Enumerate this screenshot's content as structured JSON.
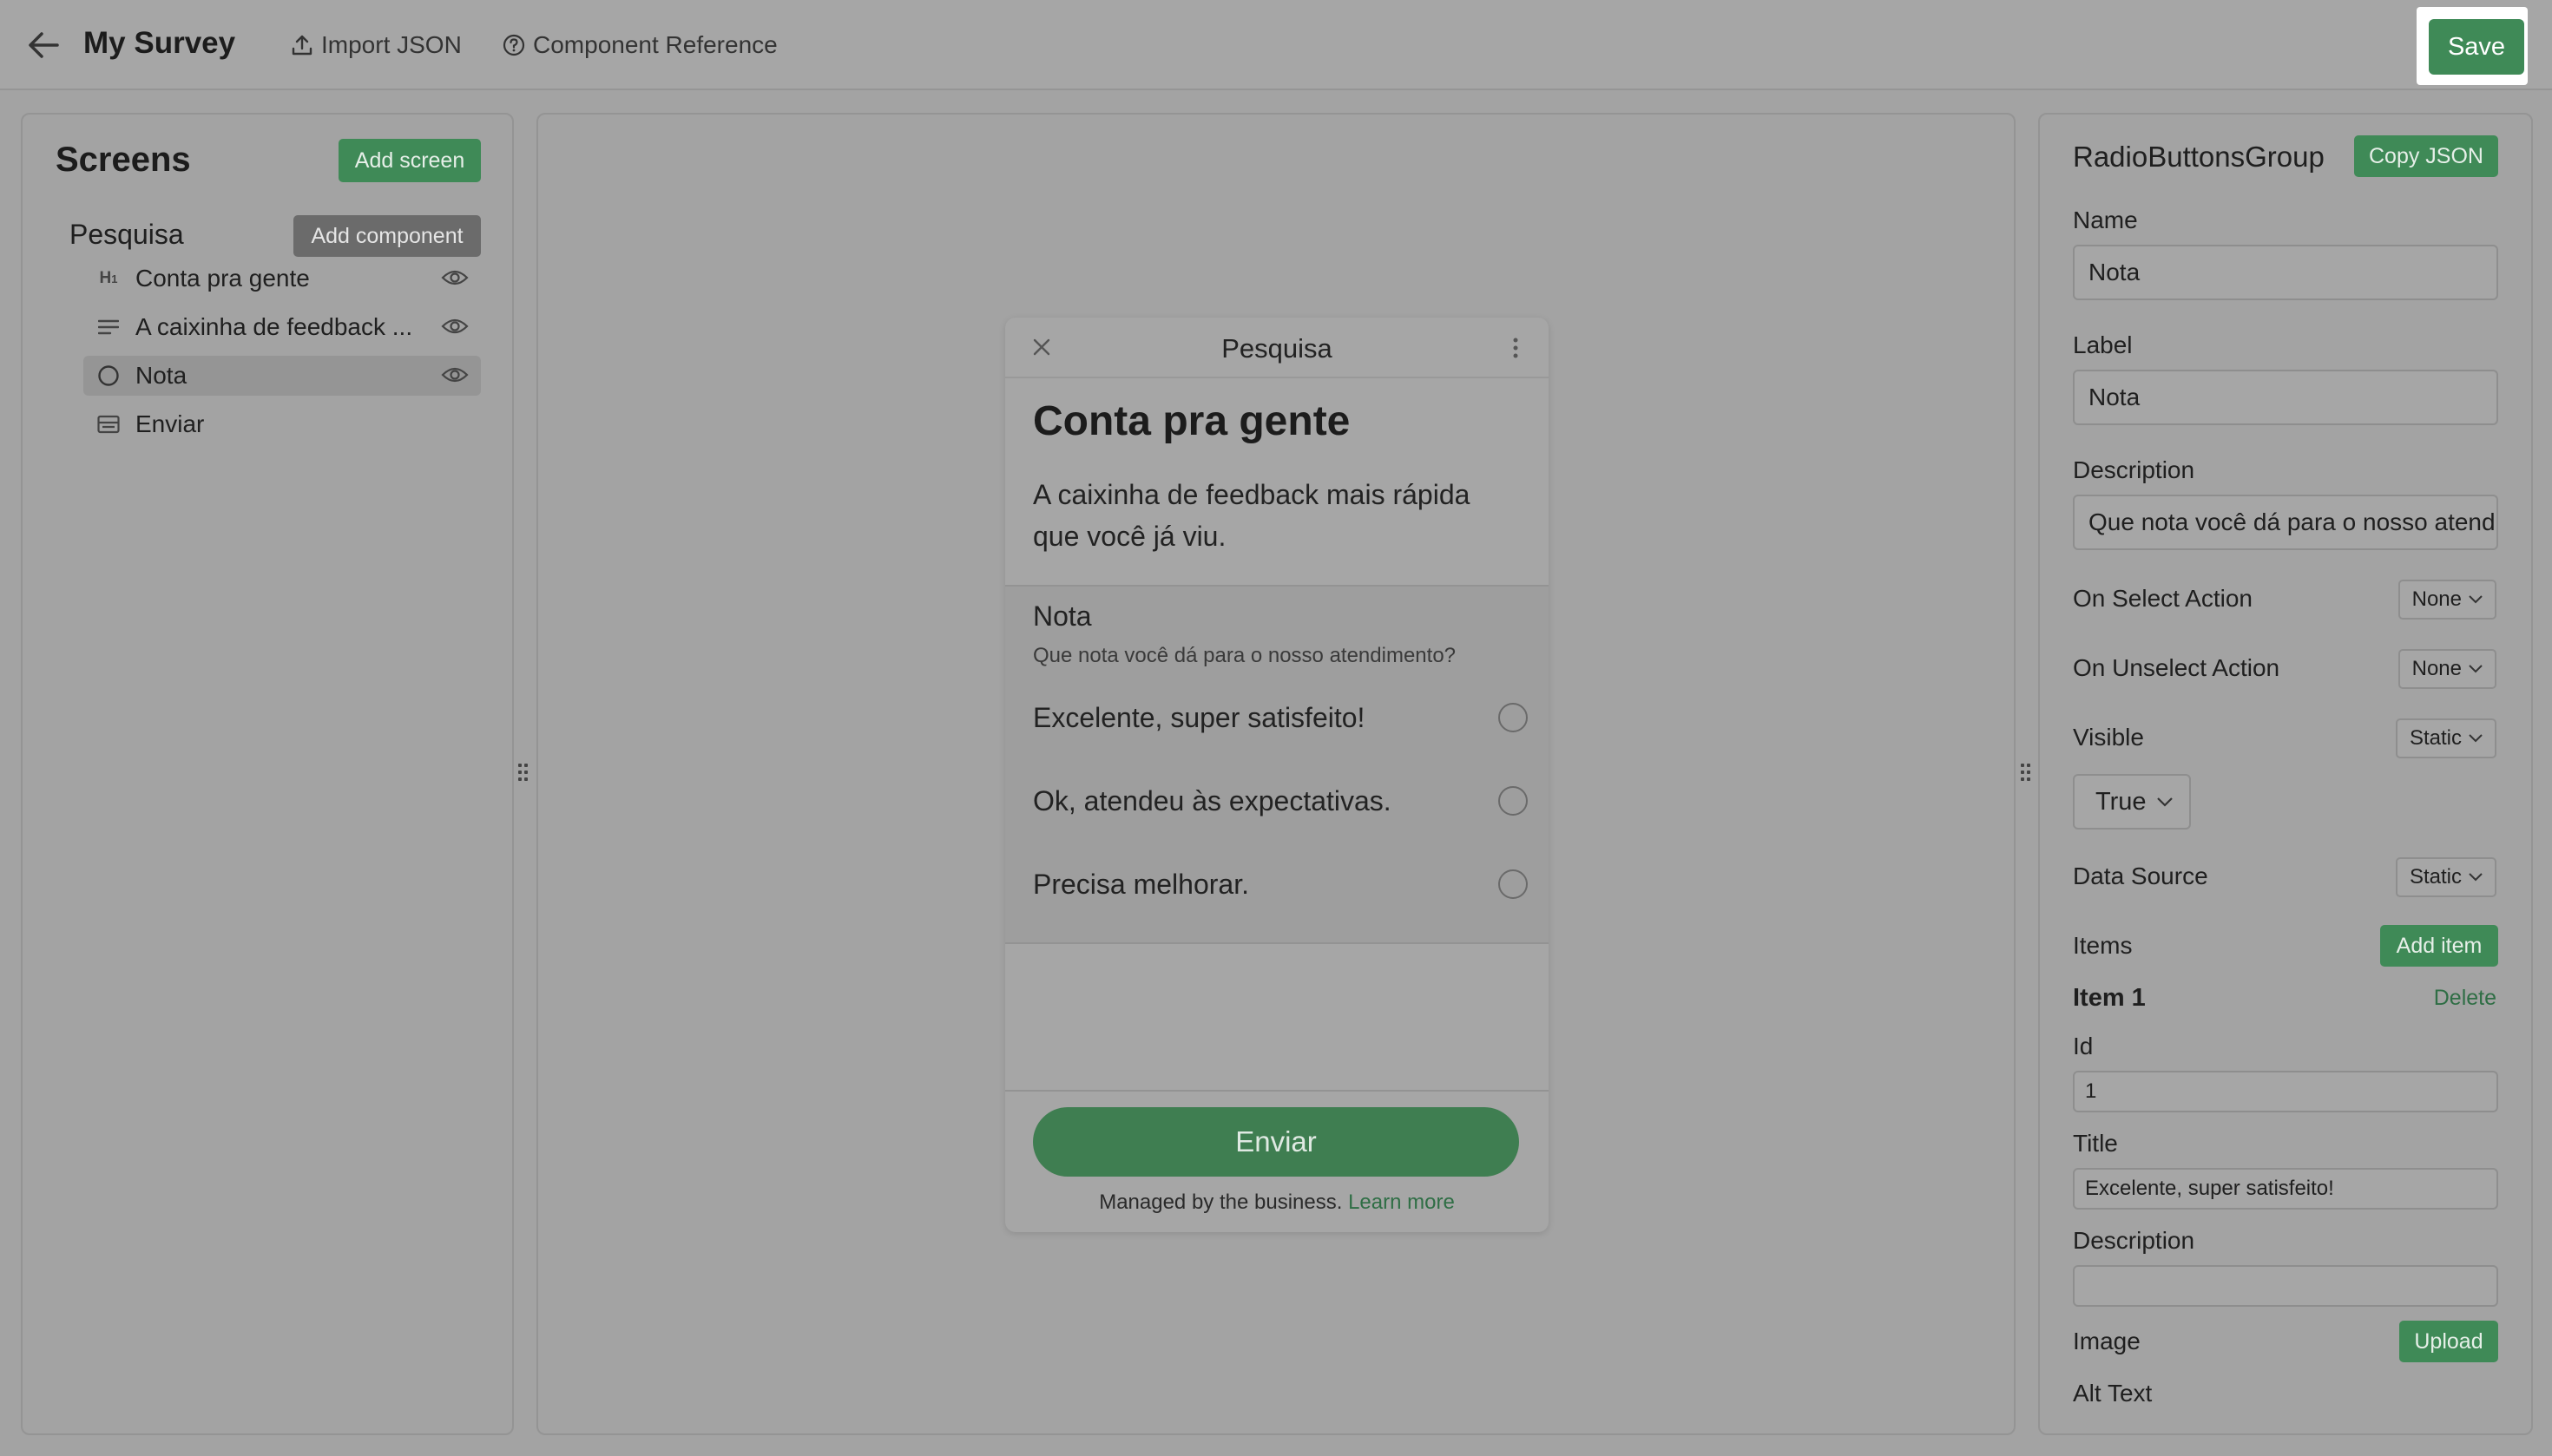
{
  "topbar": {
    "title": "My Survey",
    "import_label": "Import JSON",
    "reference_label": "Component Reference",
    "save_label": "Save"
  },
  "left": {
    "title": "Screens",
    "add_screen_label": "Add screen",
    "screen_name": "Pesquisa",
    "add_component_label": "Add component",
    "items": [
      {
        "label": "Conta pra gente",
        "icon": "heading-icon",
        "icon_text": "H1"
      },
      {
        "label": "A caixinha de feedback ...",
        "icon": "text-lines-icon"
      },
      {
        "label": "Nota",
        "icon": "radio-icon"
      },
      {
        "label": "Enviar",
        "icon": "footer-button-icon"
      }
    ]
  },
  "phone": {
    "title": "Pesquisa",
    "heading": "Conta pra gente",
    "body": "A caixinha de feedback mais rápida que você já viu.",
    "radio_label": "Nota",
    "radio_description": "Que nota você dá para o nosso atendimento?",
    "options": [
      "Excelente, super satisfeito!",
      "Ok, atendeu às expectativas.",
      "Precisa melhorar."
    ],
    "button_label": "Enviar",
    "managed_text": "Managed by the business.",
    "learn_more": "Learn more"
  },
  "right": {
    "component_type": "RadioButtonsGroup",
    "copy_json_label": "Copy JSON",
    "name_label": "Name",
    "name_value": "Nota",
    "label_label": "Label",
    "label_value": "Nota",
    "description_label": "Description",
    "description_value": "Que nota você dá para o nosso atendimento?",
    "on_select_label": "On Select Action",
    "on_select_value": "None",
    "on_unselect_label": "On Unselect Action",
    "on_unselect_value": "None",
    "visible_label": "Visible",
    "visible_mode": "Static",
    "visible_value": "True",
    "data_source_label": "Data Source",
    "data_source_mode": "Static",
    "items_label": "Items",
    "add_item_label": "Add item",
    "item_title": "Item 1",
    "delete_label": "Delete",
    "id_label": "Id",
    "id_value": "1",
    "title_label": "Title",
    "title_value": "Excelente, super satisfeito!",
    "item_description_label": "Description",
    "item_description_value": "",
    "image_label": "Image",
    "upload_label": "Upload",
    "alt_text_label": "Alt Text"
  },
  "colors": {
    "accent": "#3f8a57",
    "overlay_bg": "#a3a3a3",
    "save_highlight": "#ffffff"
  }
}
